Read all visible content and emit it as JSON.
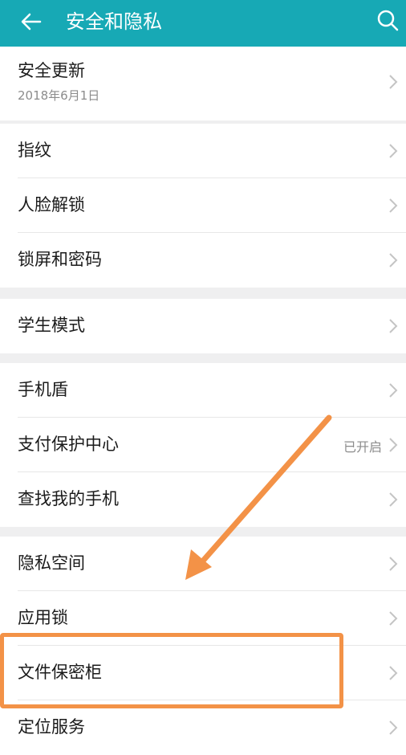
{
  "header": {
    "title": "安全和隐私"
  },
  "groups": [
    {
      "items": [
        {
          "label": "安全更新",
          "sub": "2018年6月1日"
        }
      ]
    },
    {
      "items": [
        {
          "label": "指纹"
        },
        {
          "label": "人脸解锁"
        },
        {
          "label": "锁屏和密码"
        }
      ]
    },
    {
      "items": [
        {
          "label": "学生模式"
        }
      ]
    },
    {
      "items": [
        {
          "label": "手机盾"
        },
        {
          "label": "支付保护中心",
          "status": "已开启"
        },
        {
          "label": "查找我的手机"
        }
      ]
    },
    {
      "items": [
        {
          "label": "隐私空间"
        },
        {
          "label": "应用锁"
        },
        {
          "label": "文件保密柜"
        },
        {
          "label": "定位服务"
        }
      ]
    }
  ],
  "colors": {
    "header": "#17a9b5",
    "highlight": "#f39247"
  }
}
